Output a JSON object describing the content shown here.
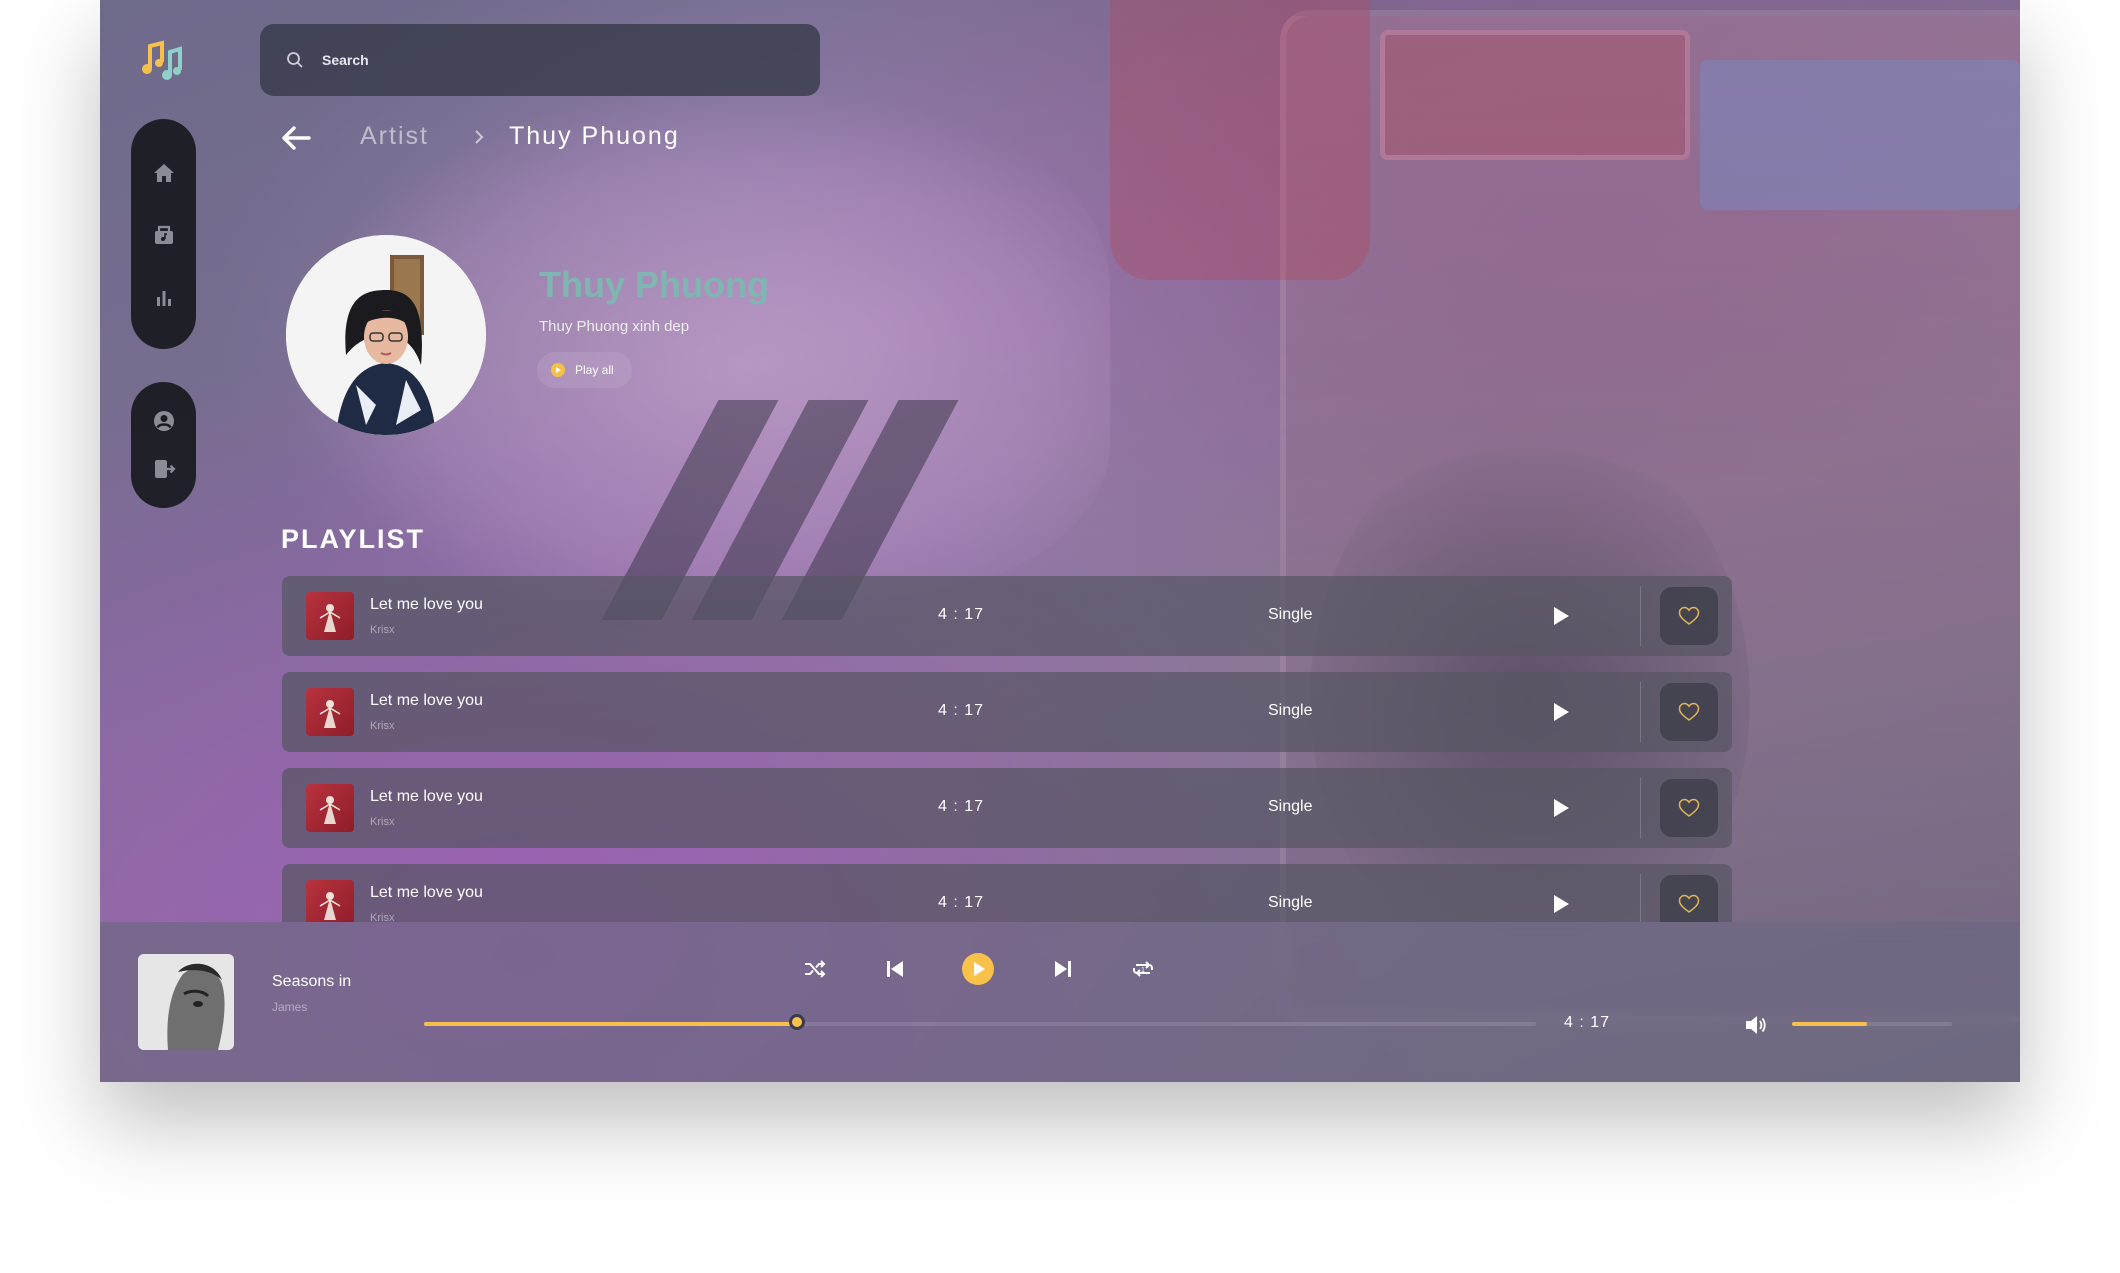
{
  "colors": {
    "accent": "#f6c04c",
    "artist_name": "#7fb6b1",
    "sidebar": "#181a1e"
  },
  "search": {
    "placeholder": "Search",
    "icon": "search-icon"
  },
  "sidebar": {
    "nav_icons": [
      "home-icon",
      "music-library-icon",
      "chart-icon"
    ],
    "user_icons": [
      "user-icon",
      "logout-icon"
    ]
  },
  "breadcrumb": {
    "parent": "Artist",
    "current": "Thuy Phuong"
  },
  "artist": {
    "name": "Thuy Phuong",
    "description": "Thuy Phuong xinh dep",
    "play_all": "Play all"
  },
  "playlist": {
    "title": "PLAYLIST",
    "tracks": [
      {
        "title": "Let me love you",
        "artist": "Krisx",
        "duration": "4 : 17",
        "type": "Single"
      },
      {
        "title": "Let me love you",
        "artist": "Krisx",
        "duration": "4 : 17",
        "type": "Single"
      },
      {
        "title": "Let me love you",
        "artist": "Krisx",
        "duration": "4 : 17",
        "type": "Single"
      },
      {
        "title": "Let me love you",
        "artist": "Krisx",
        "duration": "4 : 17",
        "type": "Single"
      }
    ]
  },
  "player": {
    "title": "Seasons in",
    "artist": "James",
    "time": "4 : 17",
    "progress": 0.335,
    "volume": 0.47
  }
}
